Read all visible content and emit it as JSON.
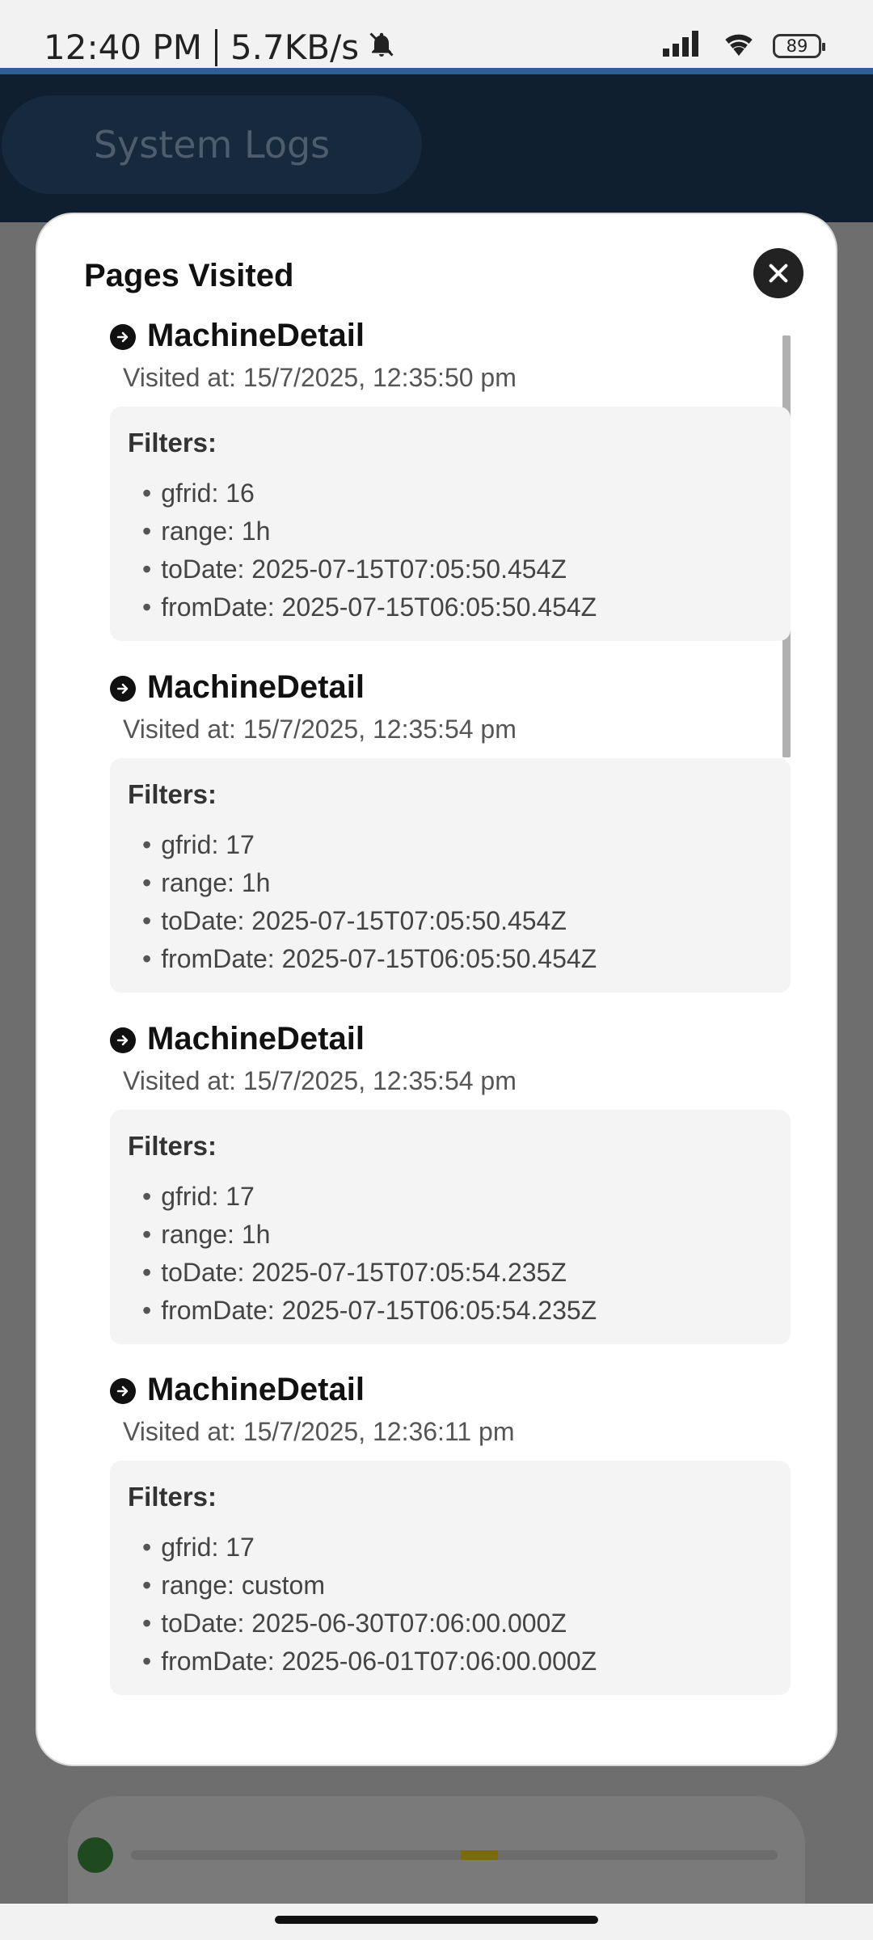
{
  "status_bar": {
    "time": "12:40 PM",
    "speed": "5.7KB/s",
    "battery": "89"
  },
  "app": {
    "header_title": "System Logs"
  },
  "modal": {
    "title": "Pages Visited",
    "filters_label": "Filters:",
    "entries": [
      {
        "page": "MachineDetail",
        "visited_at": "Visited at: 15/7/2025, 12:35:50 pm",
        "filters": [
          "gfrid: 16",
          "range: 1h",
          "toDate: 2025-07-15T07:05:50.454Z",
          "fromDate: 2025-07-15T06:05:50.454Z"
        ]
      },
      {
        "page": "MachineDetail",
        "visited_at": "Visited at: 15/7/2025, 12:35:54 pm",
        "filters": [
          "gfrid: 17",
          "range: 1h",
          "toDate: 2025-07-15T07:05:50.454Z",
          "fromDate: 2025-07-15T06:05:50.454Z"
        ]
      },
      {
        "page": "MachineDetail",
        "visited_at": "Visited at: 15/7/2025, 12:35:54 pm",
        "filters": [
          "gfrid: 17",
          "range: 1h",
          "toDate: 2025-07-15T07:05:54.235Z",
          "fromDate: 2025-07-15T06:05:54.235Z"
        ]
      },
      {
        "page": "MachineDetail",
        "visited_at": "Visited at: 15/7/2025, 12:36:11 pm",
        "filters": [
          "gfrid: 17",
          "range: custom",
          "toDate: 2025-06-30T07:06:00.000Z",
          "fromDate: 2025-06-01T07:06:00.000Z"
        ]
      }
    ]
  },
  "icons": {
    "close": "close-icon",
    "entry": "arrow-right-circle-icon",
    "mute": "bell-off-icon",
    "signal": "signal-icon",
    "wifi": "wifi-icon"
  }
}
